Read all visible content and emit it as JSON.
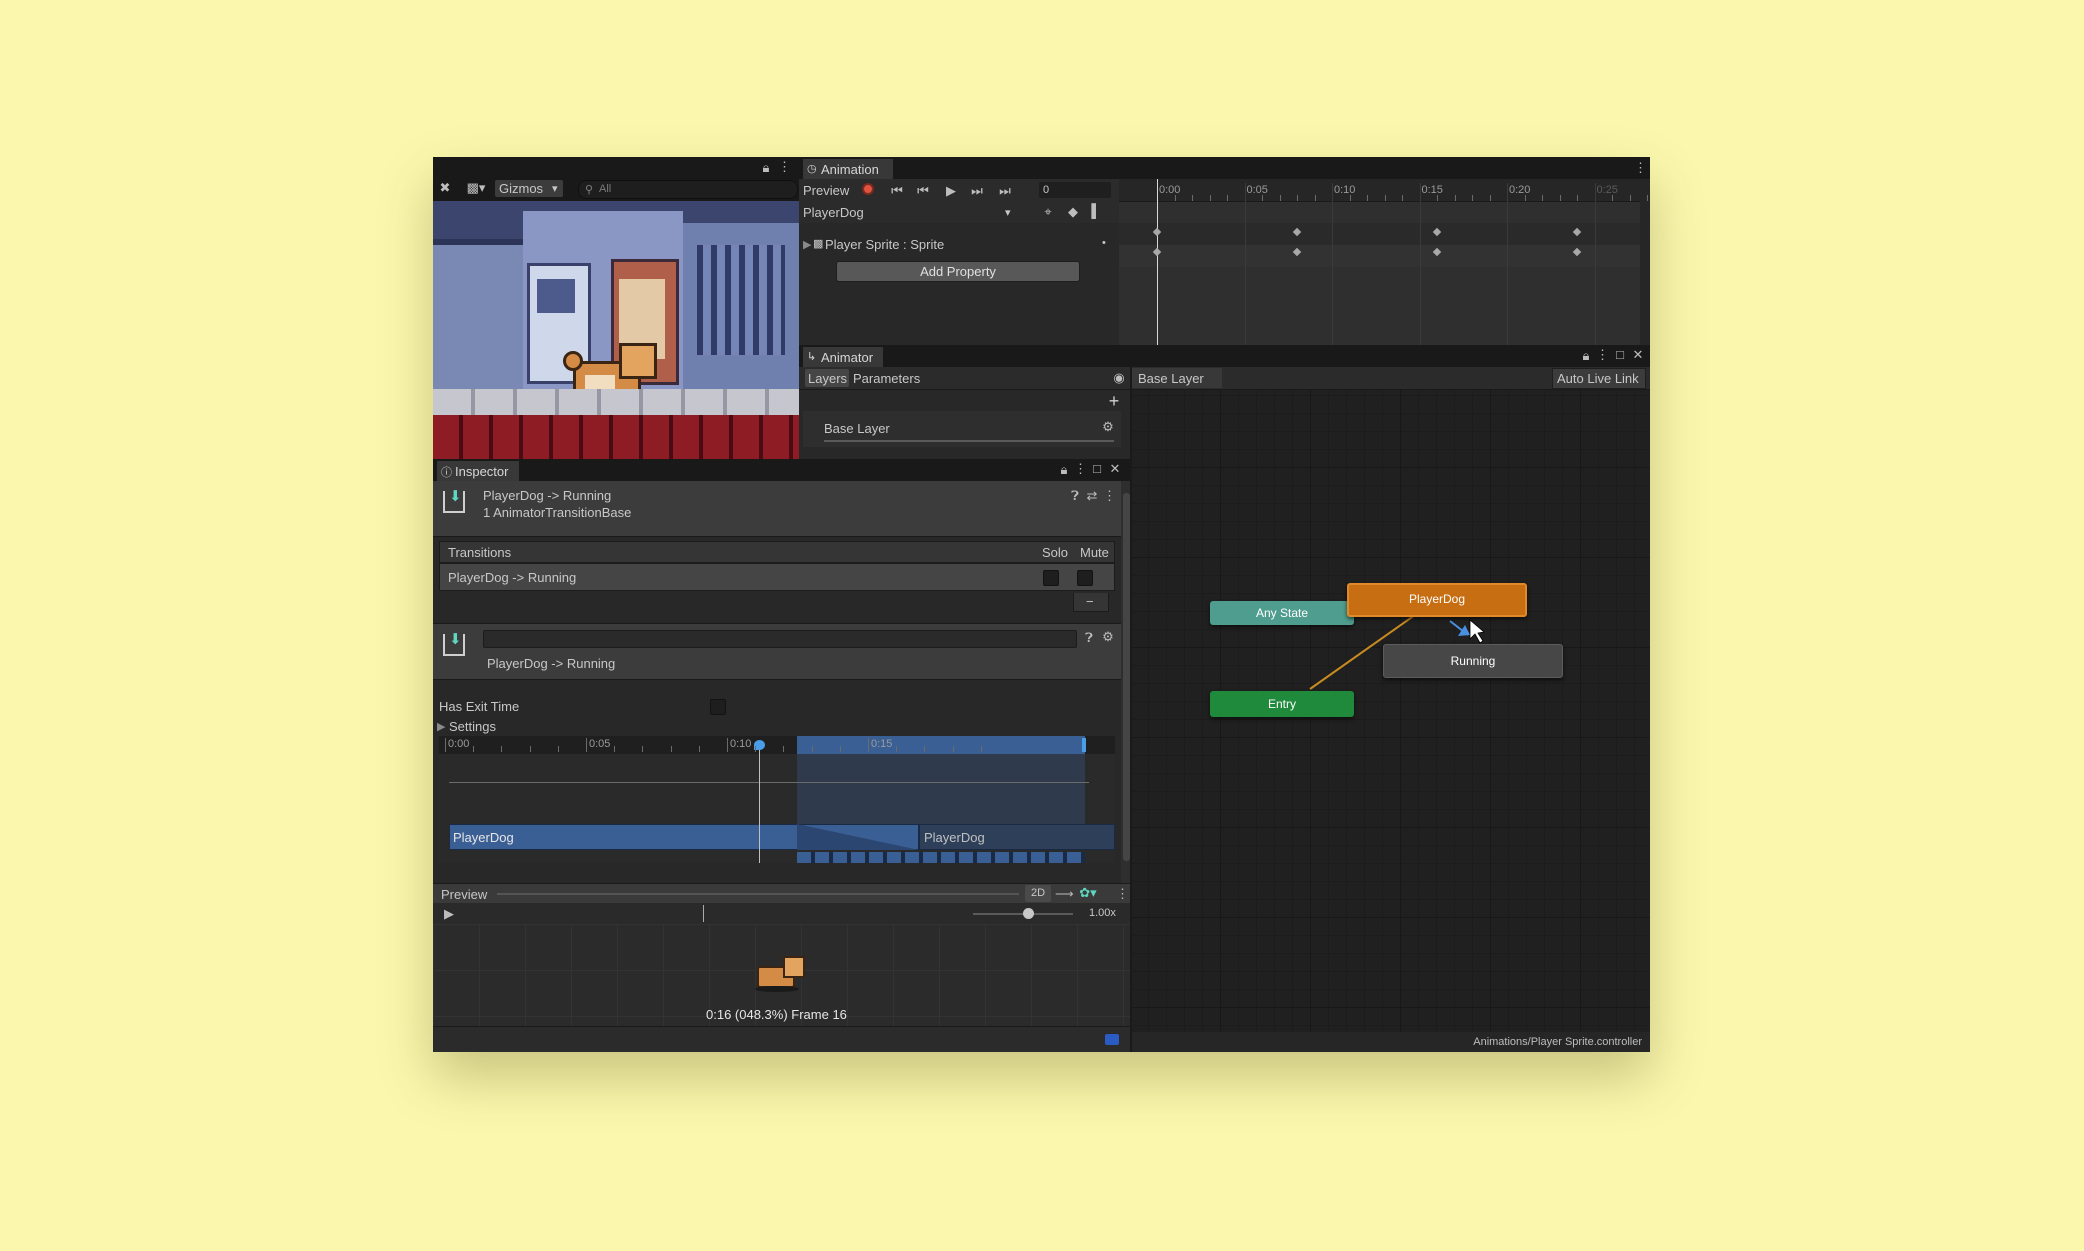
{
  "scene": {
    "gizmos_label": "Gizmos",
    "search_placeholder": "All"
  },
  "animation": {
    "tab_label": "Animation",
    "preview_label": "Preview",
    "frame_value": "0",
    "clip_name": "PlayerDog",
    "property_label": "Player Sprite : Sprite",
    "add_property_label": "Add Property",
    "timeline_labels": [
      "0:00",
      "0:05",
      "0:10",
      "0:15",
      "0:20",
      "0:25"
    ]
  },
  "animator": {
    "tab_label": "Animator",
    "layers_tab": "Layers",
    "parameters_tab": "Parameters",
    "breadcrumb": "Base Layer",
    "auto_live_link": "Auto Live Link",
    "layer_name": "Base Layer",
    "states": {
      "any_state": "Any State",
      "player_dog": "PlayerDog",
      "running": "Running",
      "entry": "Entry"
    },
    "footer_path": "Animations/Player Sprite.controller"
  },
  "inspector": {
    "tab_label": "Inspector",
    "header_title": "PlayerDog -> Running",
    "header_subtitle": "1 AnimatorTransitionBase",
    "transitions_label": "Transitions",
    "solo_label": "Solo",
    "mute_label": "Mute",
    "transition_row": "PlayerDog -> Running",
    "remove_label": "−",
    "transition_name": "PlayerDog -> Running",
    "has_exit_time_label": "Has Exit Time",
    "settings_label": "Settings",
    "timeline_labels": [
      "0:00",
      "0:05",
      "0:10",
      "0:15"
    ],
    "source_clip": "PlayerDog",
    "dest_clip": "PlayerDog"
  },
  "preview": {
    "label": "Preview",
    "mode_2d": "2D",
    "speed": "1.00x",
    "status": "0:16 (048.3%) Frame 16"
  },
  "colors": {
    "background": "#fbf8ad",
    "editor_bg": "#282828",
    "player_dog_state": "#c76d12",
    "entry_state": "#1f8a3b",
    "any_state": "#4f9d8e",
    "running_state": "#474747",
    "transition_blue": "#3a5f95",
    "record_red": "#e0533f"
  }
}
